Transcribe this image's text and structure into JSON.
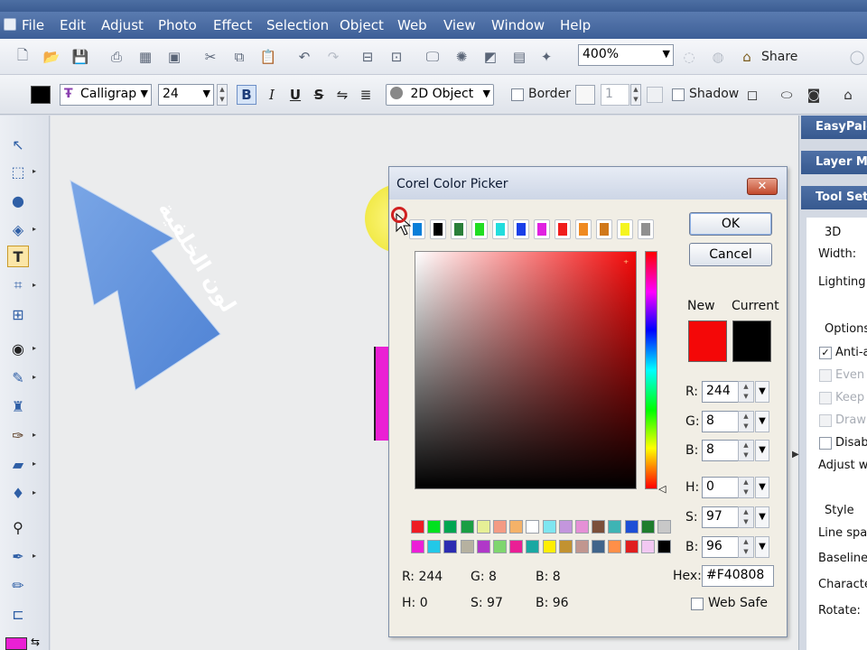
{
  "menu": [
    "File",
    "Edit",
    "Adjust",
    "Photo",
    "Effect",
    "Selection",
    "Object",
    "Web",
    "View",
    "Window",
    "Help"
  ],
  "toolbar1": {
    "zoom": "400%",
    "share_label": "Share"
  },
  "toolbar2": {
    "font_name": "Calligrap",
    "font_size": "24",
    "bold": "B",
    "italic": "I",
    "underline": "U",
    "strike": "S",
    "object_mode": "2D Object",
    "border_label": "Border",
    "border_width": "1",
    "shadow_label": "Shadow"
  },
  "panels": {
    "easypalette": "EasyPale",
    "layer_manager": "Layer Ma",
    "tool_settings": "Tool Sett",
    "section_3d": "3D",
    "width_label": "Width:",
    "lighting_label": "Lighting:",
    "options_label": "Options",
    "anti_alias": "Anti-a",
    "even": "Even",
    "keep": "Keep",
    "draw": "Draw",
    "disable": "Disab",
    "adjust_width": "Adjust wi",
    "style_label": "Style",
    "line_spacing": "Line spac",
    "baseline": "Baseline",
    "character": "Characte",
    "rotate": "Rotate:"
  },
  "canvas": {
    "arrow_text": "لون الخلفية"
  },
  "dialog": {
    "title": "Corel Color Picker",
    "ok": "OK",
    "cancel": "Cancel",
    "close_glyph": "✕",
    "new_label": "New",
    "current_label": "Current",
    "r_label": "R:",
    "g_label": "G:",
    "b_label": "B:",
    "h_label": "H:",
    "s_label": "S:",
    "b2_label": "B:",
    "r": "244",
    "g": "8",
    "b": "8",
    "h": "0",
    "s": "97",
    "bv": "96",
    "hex_label": "Hex:",
    "hex": "#F40808",
    "web_safe": "Web Safe",
    "readout_r": "R: 244",
    "readout_g": "G: 8",
    "readout_b": "B: 8",
    "readout_h": "H: 0",
    "readout_s": "S: 97",
    "readout_bv": "B: 96",
    "new_color": "#f40808",
    "current_color": "#000000",
    "recent_colors": [
      "#0a7fd9",
      "#000000",
      "#2a7f3a",
      "#22dd22",
      "#22dddd",
      "#1a3fe8",
      "#e021e0",
      "#f01d1d",
      "#ef8a22",
      "#d0781a",
      "#f5f520",
      "#909090"
    ],
    "palette_row1": [
      "#ee1c24",
      "#00e11e",
      "#00a651",
      "#1a9e44",
      "#e6ef96",
      "#f49b84",
      "#f4b268",
      "#ffffff",
      "#7ee6f0",
      "#c396dd",
      "#e590d6",
      "#7b4f3a",
      "#3eb4b4",
      "#1d4fd6",
      "#1f7d2d",
      "#c8c8c8"
    ],
    "palette_row2": [
      "#ec1fd7",
      "#22c8e8",
      "#2b2bb1",
      "#b6b1a0",
      "#b038c8",
      "#7fd66e",
      "#ea1f95",
      "#1aa8a2",
      "#ffee00",
      "#c29231",
      "#c1968f",
      "#40648a",
      "#ff8f48",
      "#e01e1e",
      "#f2c8f2",
      "#000000"
    ]
  }
}
